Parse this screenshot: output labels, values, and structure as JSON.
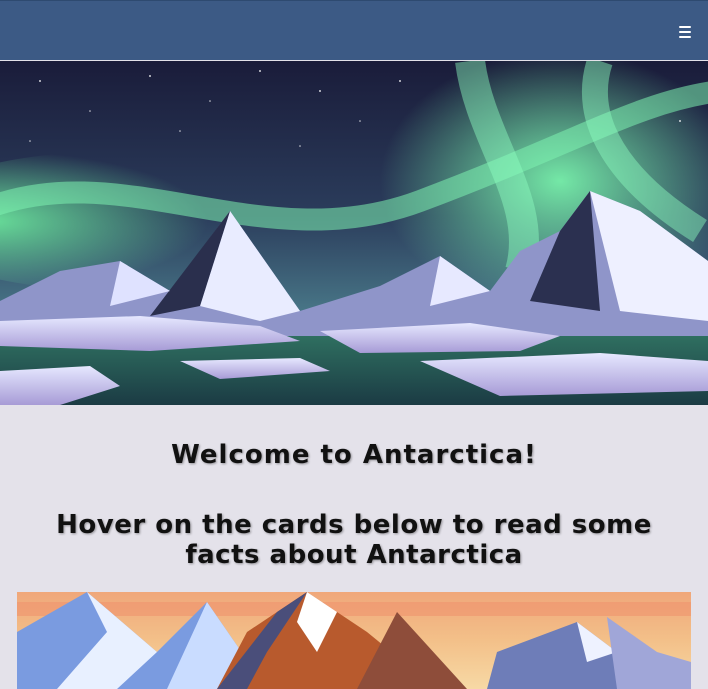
{
  "navbar": {
    "menu_icon": "hamburger-menu-icon"
  },
  "hero": {
    "image": "antarctic-aurora-landscape",
    "colors": {
      "sky_top": "#1b1f3d",
      "aurora": "#4ee39a",
      "ice": "#cfd3f2"
    }
  },
  "main": {
    "welcome": "Welcome to Antarctica!",
    "subtitle": "Hover on the cards below to read some facts about Antarctica"
  },
  "cards": [
    {
      "image": "sunset-mountains-card"
    }
  ],
  "colors": {
    "navbar_bg": "#3c5a85",
    "page_bg": "#e4e2ea"
  }
}
